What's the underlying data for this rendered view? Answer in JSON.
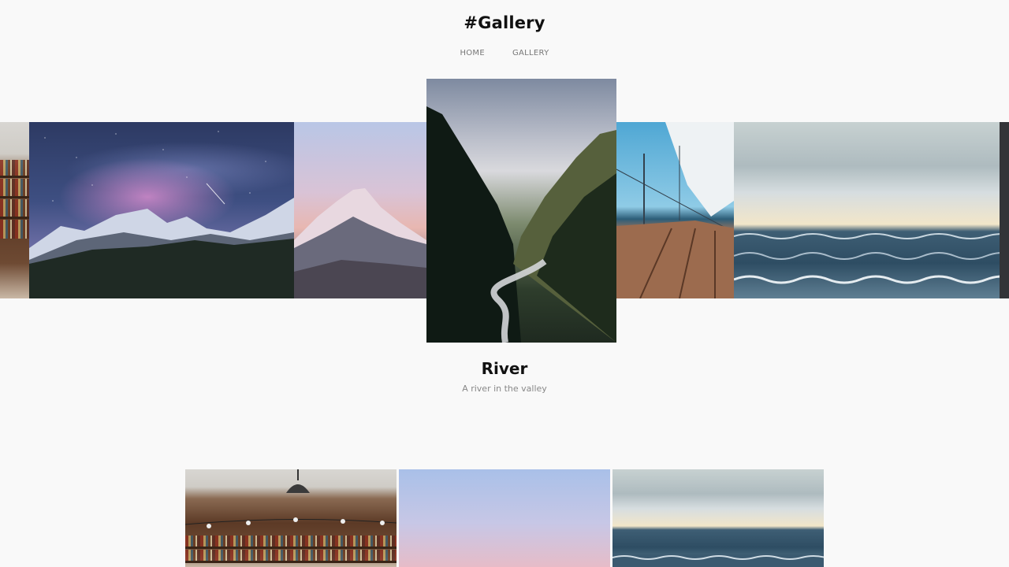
{
  "header": {
    "title": "#Gallery",
    "nav": [
      {
        "label": "HOME"
      },
      {
        "label": "GALLERY"
      }
    ]
  },
  "slider": {
    "active": {
      "title": "River",
      "description": "A river in the valley"
    },
    "slides": [
      {
        "name": "library"
      },
      {
        "name": "milky-way"
      },
      {
        "name": "mountain-peak"
      },
      {
        "name": "river"
      },
      {
        "name": "sailboat"
      },
      {
        "name": "sea"
      },
      {
        "name": "stars"
      }
    ]
  },
  "grid": [
    {
      "name": "library"
    },
    {
      "name": "mountain-peak"
    },
    {
      "name": "sea"
    }
  ],
  "colors": {
    "background": "#f9f9f9",
    "title": "#111111",
    "muted": "#888888"
  }
}
